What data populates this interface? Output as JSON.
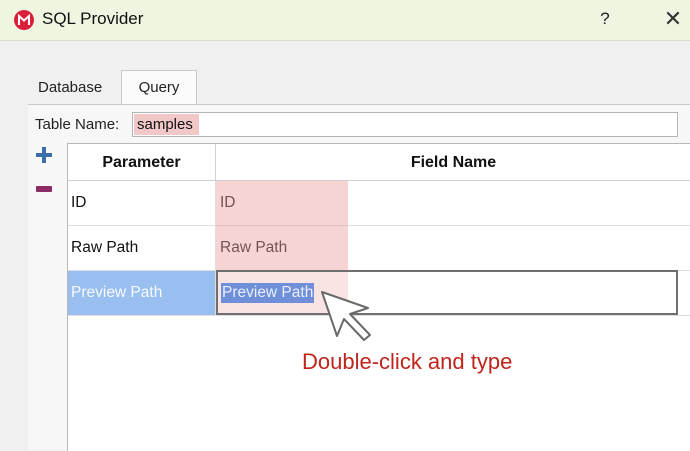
{
  "window": {
    "title": "SQL Provider",
    "help_label": "?",
    "close_label": "✕",
    "accent": "#d9213a"
  },
  "tabs": [
    {
      "label": "Database",
      "selected": false
    },
    {
      "label": "Query",
      "selected": true
    }
  ],
  "table_name": {
    "label": "Table Name:",
    "value": "samples"
  },
  "icons": {
    "add": "plus-icon",
    "remove": "minus-icon"
  },
  "grid": {
    "headers": [
      "Parameter",
      "Field Name"
    ],
    "rows": [
      {
        "parameter": "ID",
        "field": "ID"
      },
      {
        "parameter": "Raw Path",
        "field": "Raw Path"
      },
      {
        "parameter": "Preview Path",
        "field": "Preview Path"
      }
    ],
    "selected_row": 2
  },
  "annotation": "Double-click and type"
}
